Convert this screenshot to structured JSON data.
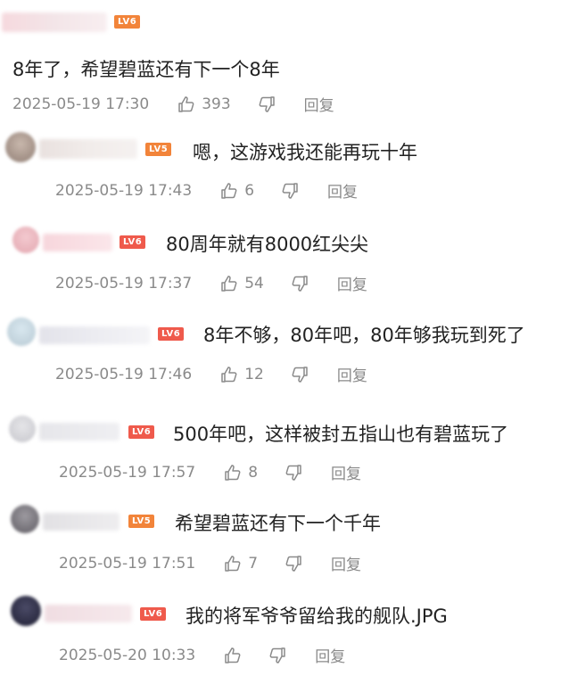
{
  "comments": [
    {
      "level": "LV6",
      "text": "8年了，希望碧蓝还有下一个8年",
      "time": "2025-05-19 17:30",
      "likes": "393",
      "reply": "回复"
    },
    {
      "level": "LV5",
      "text": "嗯，这游戏我还能再玩十年",
      "time": "2025-05-19 17:43",
      "likes": "6",
      "reply": "回复"
    },
    {
      "level": "LV6",
      "text": "80周年就有8000红尖尖",
      "time": "2025-05-19 17:37",
      "likes": "54",
      "reply": "回复"
    },
    {
      "level": "LV6",
      "text": "8年不够，80年吧，80年够我玩到死了",
      "time": "2025-05-19 17:46",
      "likes": "12",
      "reply": "回复"
    },
    {
      "level": "LV6",
      "text": "500年吧，这样被封五指山也有碧蓝玩了",
      "time": "2025-05-19 17:57",
      "likes": "8",
      "reply": "回复"
    },
    {
      "level": "LV5",
      "text": "希望碧蓝还有下一个千年",
      "time": "2025-05-19 17:51",
      "likes": "7",
      "reply": "回复"
    },
    {
      "level": "LV6",
      "text": "我的将军爷爷留给我的舰队.JPG",
      "time": "2025-05-20 10:33",
      "likes": "",
      "reply": "回复"
    }
  ],
  "colors": {
    "level_red": "#ef5a4c",
    "level_orange": "#f2843a",
    "meta_gray": "#8a8a8a"
  },
  "icons": {
    "like": "thumbs-up-icon",
    "dislike": "thumbs-down-icon"
  }
}
